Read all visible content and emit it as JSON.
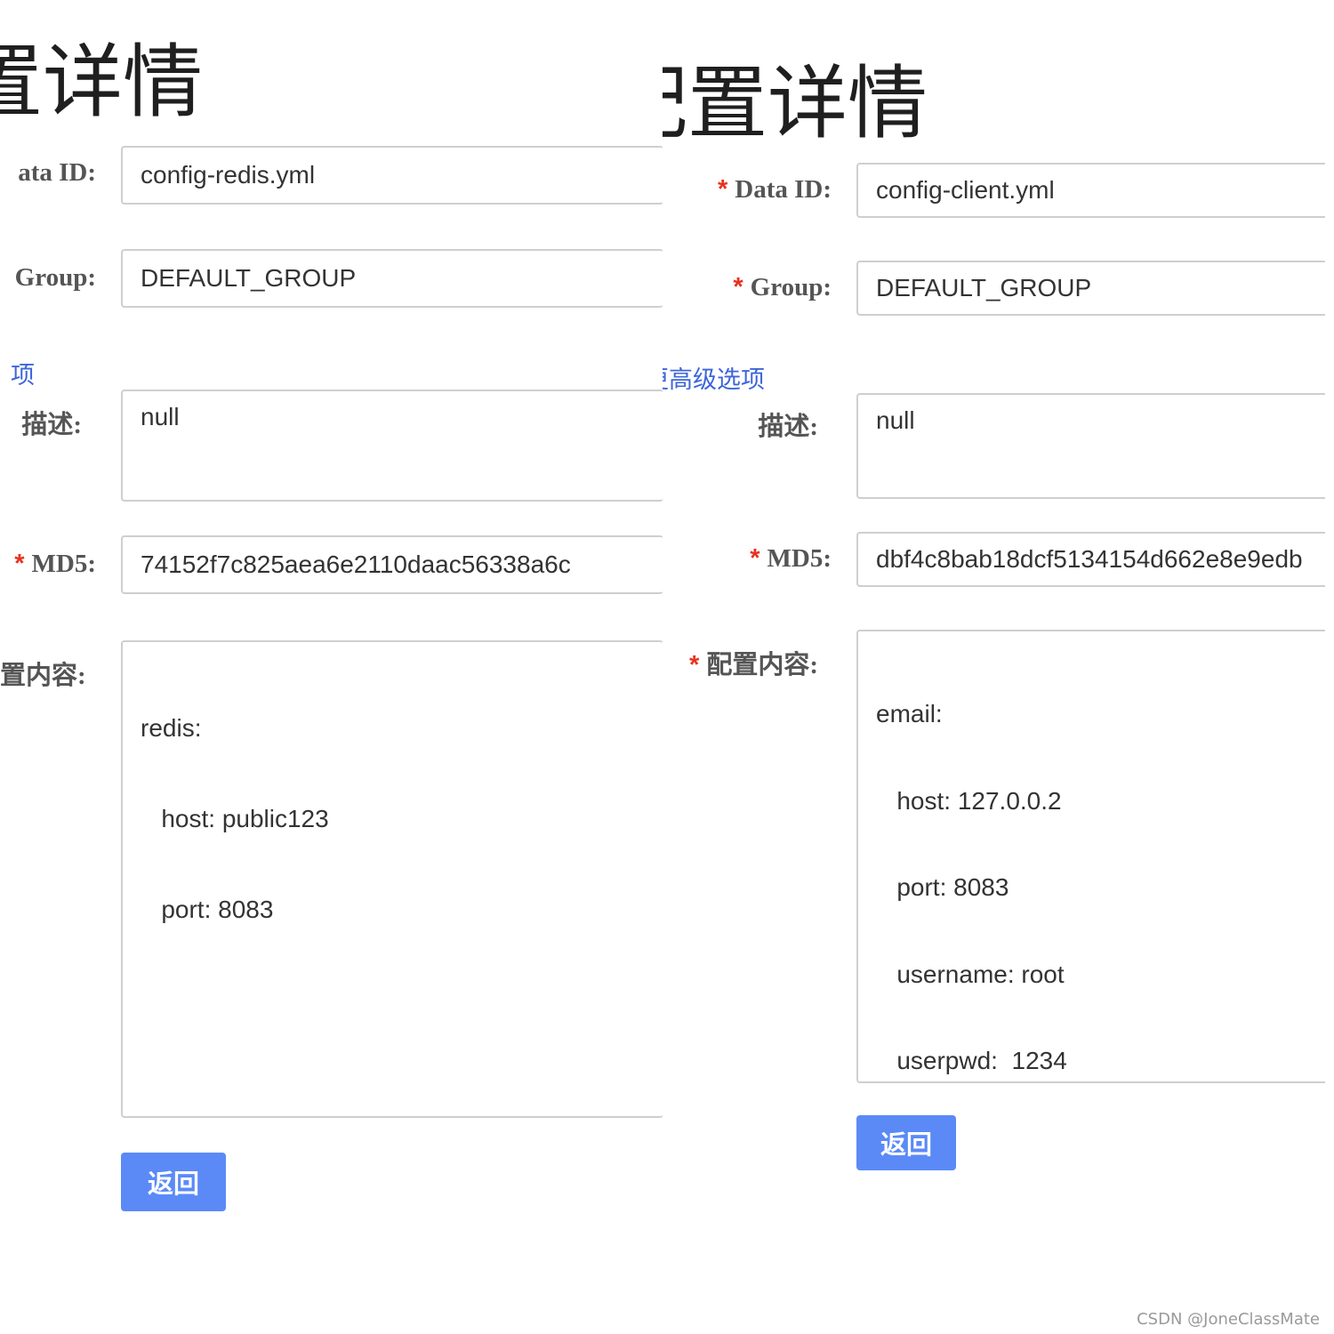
{
  "left": {
    "title": "置详情",
    "data_id": {
      "label": "ata ID:",
      "value": "config-redis.yml"
    },
    "group": {
      "label": "Group:",
      "value": "DEFAULT_GROUP"
    },
    "advanced_link": "项",
    "description": {
      "label": "描述:",
      "value": "null"
    },
    "md5": {
      "required_mark": "*",
      "label": "MD5:",
      "value": "74152f7c825aea6e2110daac56338a6c"
    },
    "content": {
      "label": "置内容:",
      "lines": [
        "redis:",
        "   host: public123",
        "   port: 8083"
      ]
    },
    "back_button": "返回"
  },
  "right": {
    "title": "配置详情",
    "data_id": {
      "required_mark": "*",
      "label": "Data ID:",
      "value": "config-client.yml"
    },
    "group": {
      "required_mark": "*",
      "label": "Group:",
      "value": "DEFAULT_GROUP"
    },
    "advanced_link": "更高级选项",
    "description": {
      "label": "描述:",
      "value": "null"
    },
    "md5": {
      "required_mark": "*",
      "label": "MD5:",
      "value": "dbf4c8bab18dcf5134154d662e8e9edb"
    },
    "content": {
      "required_mark": "*",
      "label": "配置内容:",
      "lines": [
        "email:",
        "   host: 127.0.0.2",
        "   port: 8083",
        "   username: root",
        "   userpwd:  1234"
      ]
    },
    "back_button": "返回"
  },
  "watermark": "CSDN @JoneClassMate"
}
